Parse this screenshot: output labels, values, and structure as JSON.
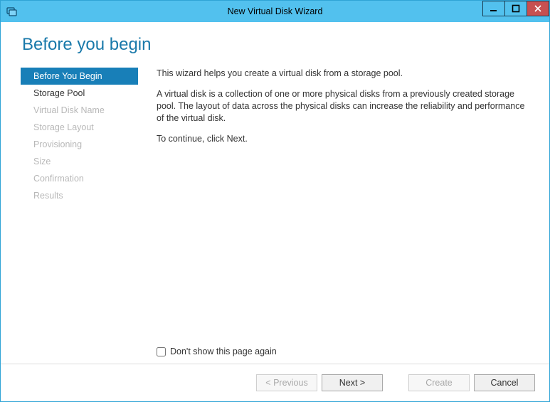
{
  "window": {
    "title": "New Virtual Disk Wizard"
  },
  "page": {
    "heading": "Before you begin"
  },
  "nav": {
    "items": [
      {
        "label": "Before You Begin",
        "enabled": true,
        "selected": true
      },
      {
        "label": "Storage Pool",
        "enabled": true,
        "selected": false
      },
      {
        "label": "Virtual Disk Name",
        "enabled": false,
        "selected": false
      },
      {
        "label": "Storage Layout",
        "enabled": false,
        "selected": false
      },
      {
        "label": "Provisioning",
        "enabled": false,
        "selected": false
      },
      {
        "label": "Size",
        "enabled": false,
        "selected": false
      },
      {
        "label": "Confirmation",
        "enabled": false,
        "selected": false
      },
      {
        "label": "Results",
        "enabled": false,
        "selected": false
      }
    ]
  },
  "body": {
    "p1": "This wizard helps you create a virtual disk from a storage pool.",
    "p2": "A virtual disk is a collection of one or more physical disks from a previously created storage pool. The layout of data across the physical disks can increase the reliability and performance of the virtual disk.",
    "p3": "To continue, click Next.",
    "donotshow_label": "Don't show this page again",
    "donotshow_checked": false
  },
  "footer": {
    "previous": {
      "label": "< Previous",
      "enabled": false
    },
    "next": {
      "label": "Next >",
      "enabled": true
    },
    "create": {
      "label": "Create",
      "enabled": false
    },
    "cancel": {
      "label": "Cancel",
      "enabled": true
    }
  }
}
